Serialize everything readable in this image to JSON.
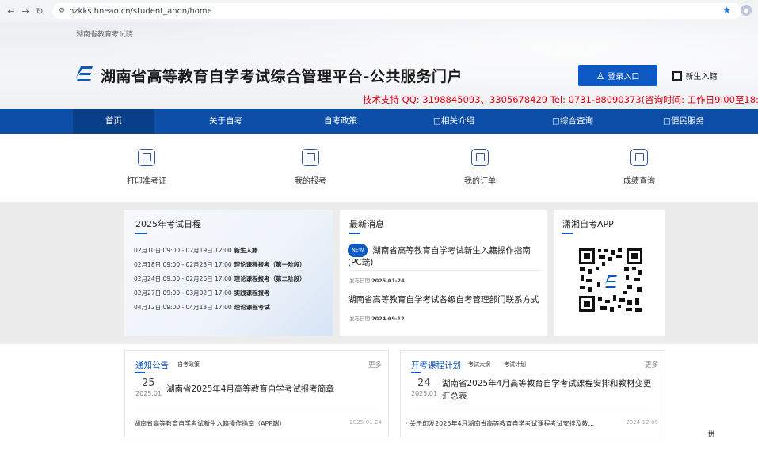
{
  "browser": {
    "url": "nzkks.hneao.cn/student_anon/home"
  },
  "header": {
    "org": "湖南省教育考试院",
    "title": "湖南省高等教育自学考试综合管理平台-公共服务门户",
    "login_label": "登录入口",
    "new_student_label": "新生入籍",
    "support": "技术支持 QQ: 3198845093、3305678429 Tel: 0731-88090373(咨询时间: 工作日9:00至18:00)"
  },
  "nav": {
    "items": [
      {
        "label": "首页"
      },
      {
        "label": "关于自考"
      },
      {
        "label": "自考政策"
      },
      {
        "label": "□相关介绍"
      },
      {
        "label": "□综合查询"
      },
      {
        "label": "□便民服务"
      }
    ]
  },
  "quick": {
    "items": [
      {
        "label": "打印准考证",
        "icon": "admission-ticket-icon"
      },
      {
        "label": "我的报考",
        "icon": "registration-icon"
      },
      {
        "label": "我的订单",
        "icon": "order-icon"
      },
      {
        "label": "成绩查询",
        "icon": "score-query-icon"
      }
    ]
  },
  "schedule": {
    "title": "2025年考试日程",
    "rows": [
      {
        "time": "02月10日 09:00 - 02月19日 12:00",
        "event": "新生入籍"
      },
      {
        "time": "02月18日 09:00 - 02月23日 17:00",
        "event": "理论课程报考（第一阶段）"
      },
      {
        "time": "02月24日 09:00 - 02月26日 17:00",
        "event": "理论课程报考（第二阶段）"
      },
      {
        "time": "02月27日 09:00 - 03月02日 17:00",
        "event": "实践课程报考"
      },
      {
        "time": "04月12日 09:00 - 04月13日 17:00",
        "event": "理论课程考试"
      }
    ]
  },
  "news": {
    "title": "最新消息",
    "badge": "NEW",
    "items": [
      {
        "title": "湖南省高等教育自学考试新生入籍操作指南(PC端)",
        "date_label": "发布日期",
        "date": "2025-01-24"
      },
      {
        "title": "湖南省高等教育自学考试各级自考管理部门联系方式",
        "date_label": "发布日期",
        "date": "2024-09-12"
      }
    ]
  },
  "app": {
    "title": "潇湘自考APP"
  },
  "notice": {
    "title": "通知公告",
    "tags": [
      "自考政策"
    ],
    "more": "更多",
    "featured": {
      "day": "25",
      "month": "2025.01",
      "title": "湖南省2025年4月高等教育自学考试报考简章"
    },
    "item": {
      "title": "· 湖南省高等教育自学考试新生入籍操作指南（APP端）",
      "date": "2025-01-24"
    }
  },
  "plan": {
    "title": "开考课程计划",
    "tags": [
      "考试大纲",
      "考试计划"
    ],
    "more": "更多",
    "featured": {
      "day": "24",
      "month": "2025.01",
      "title": "湖南省2025年4月高等教育自学考试课程安排和教材变更汇总表"
    },
    "item": {
      "title": "· 关于印发2025年4月湖南省高等教育自学考试课程考试安排及教...",
      "date": "2024-12-09"
    }
  },
  "corner": {
    "label": "拼"
  },
  "colors": {
    "brand_blue": "#0d58c2",
    "nav_blue": "#0d4fa8",
    "support_red": "#e60012"
  }
}
